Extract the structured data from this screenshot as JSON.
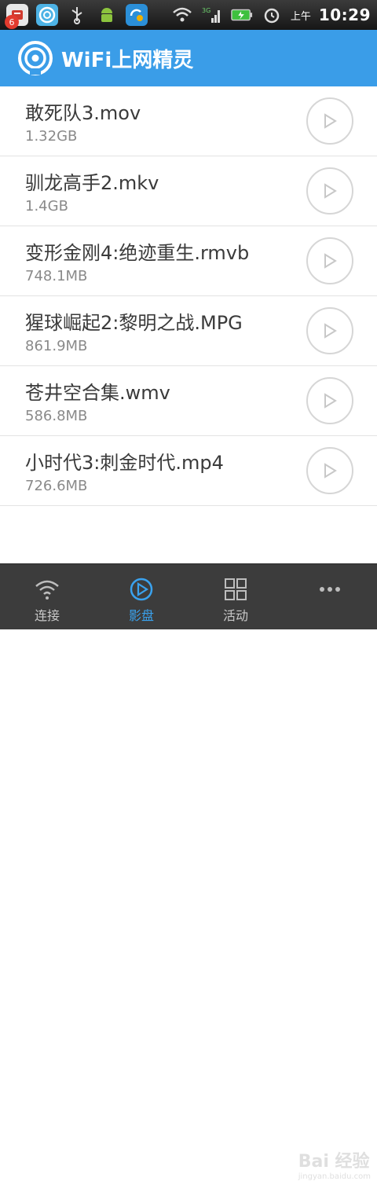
{
  "status_bar": {
    "notification_count": "6",
    "ampm": "上午",
    "time": "10:29",
    "network_label": "3G"
  },
  "app": {
    "title": "WiFi上网精灵",
    "accent_color": "#3a9de8"
  },
  "videos": [
    {
      "name": "敢死队3.mov",
      "size": "1.32GB"
    },
    {
      "name": "驯龙高手2.mkv",
      "size": "1.4GB"
    },
    {
      "name": "变形金刚4:绝迹重生.rmvb",
      "size": "748.1MB"
    },
    {
      "name": "猩球崛起2:黎明之战.MPG",
      "size": "861.9MB"
    },
    {
      "name": "苍井空合集.wmv",
      "size": "586.8MB"
    },
    {
      "name": "小时代3:刺金时代.mp4",
      "size": "726.6MB"
    }
  ],
  "tabs": [
    {
      "label": "连接",
      "icon": "wifi-icon",
      "active": false
    },
    {
      "label": "影盘",
      "icon": "play-icon",
      "active": true
    },
    {
      "label": "活动",
      "icon": "grid-icon",
      "active": false
    },
    {
      "label": "",
      "icon": "more-icon",
      "active": false
    }
  ],
  "watermark": {
    "brand": "Bai 经验",
    "url": "jingyan.baidu.com"
  }
}
